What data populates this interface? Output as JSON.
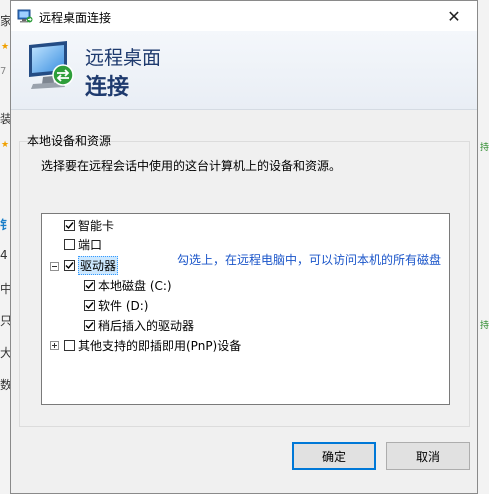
{
  "window": {
    "title": "远程桌面连接",
    "close_glyph": "✕"
  },
  "banner": {
    "line1": "远程桌面",
    "line2": "连接"
  },
  "group": {
    "label": "本地设备和资源",
    "description": "选择要在远程会话中使用的这台计算机上的设备和资源。"
  },
  "tree": {
    "items": [
      {
        "label": "智能卡",
        "checked": true
      },
      {
        "label": "端口",
        "checked": false
      },
      {
        "label": "驱动器",
        "checked": true,
        "expanded": true,
        "selected": true
      },
      {
        "label": "本地磁盘 (C:)",
        "checked": true
      },
      {
        "label": "软件 (D:)",
        "checked": true
      },
      {
        "label": "稍后插入的驱动器",
        "checked": true
      },
      {
        "label": "其他支持的即插即用(PnP)设备",
        "checked": false,
        "expanded": false
      }
    ]
  },
  "annotation": "勾选上，在远程电脑中，可以访问本机的所有磁盘",
  "buttons": {
    "ok": "确定",
    "cancel": "取消"
  },
  "background": {
    "left_glyphs": [
      "家",
      "7",
      "装",
      "钅",
      "4",
      "中",
      "只",
      "大",
      "数"
    ],
    "right_glyphs": [
      "持",
      "持"
    ]
  },
  "colors": {
    "banner_text": "#1e3a6e",
    "annotation": "#1a55c9",
    "selection": "#cce8ff",
    "primary_button_border": "#0078d7"
  }
}
